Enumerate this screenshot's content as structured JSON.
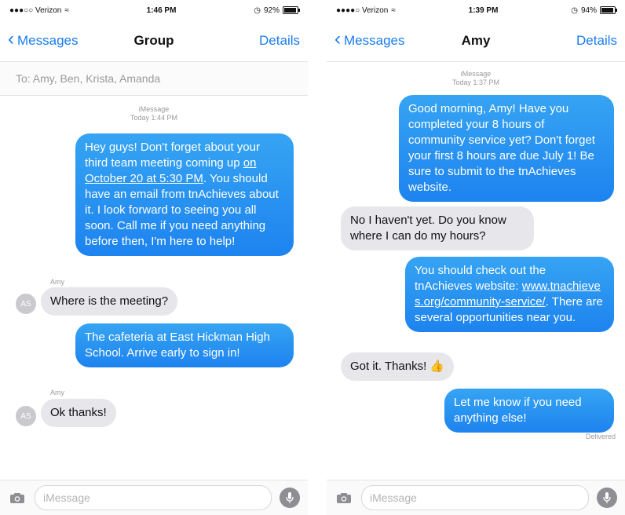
{
  "left": {
    "status": {
      "carrier": "●●●○○ Verizon",
      "time": "1:46 PM",
      "battery": "92%",
      "battery_level": 0.92
    },
    "nav": {
      "back": "Messages",
      "title": "Group",
      "details": "Details"
    },
    "to_field": "To: Amy, Ben, Krista, Amanda",
    "timestamp": {
      "service": "iMessage",
      "time": "Today 1:44 PM"
    },
    "messages": [
      {
        "type": "out",
        "pre": "Hey guys! Don't forget about your third team meeting coming up ",
        "link": "on October 20 at 5:30 PM",
        "post": ". You should have an email from tnAchieves about it. I look forward to seeing you all soon. Call me if you need anything before then, I'm here to help!"
      },
      {
        "type": "in",
        "sender": "Amy",
        "avatar": "AS",
        "text": "Where is the meeting?"
      },
      {
        "type": "out",
        "text": "The cafeteria at East Hickman High School. Arrive early to sign in!"
      },
      {
        "type": "in",
        "sender": "Amy",
        "avatar": "AS",
        "text": "Ok thanks!"
      }
    ],
    "input": {
      "placeholder": "iMessage"
    }
  },
  "right": {
    "status": {
      "carrier": "●●●●○ Verizon",
      "time": "1:39 PM",
      "battery": "94%",
      "battery_level": 0.94
    },
    "nav": {
      "back": "Messages",
      "title": "Amy",
      "details": "Details"
    },
    "timestamp": {
      "service": "iMessage",
      "time": "Today 1:37 PM"
    },
    "messages": [
      {
        "type": "out",
        "text": "Good morning, Amy! Have you completed your 8 hours of community service yet? Don't forget your first 8 hours are due July 1! Be sure to submit to the tnAchieves website."
      },
      {
        "type": "in",
        "text": "No I haven't yet. Do you know where I can do my hours?"
      },
      {
        "type": "out",
        "pre": "You should check out the tnAchieves website: ",
        "link": "www.tnachieves.org/community-service/",
        "post": ". There are several opportunities near you."
      },
      {
        "type": "in",
        "text": "Got it. Thanks! 👍"
      },
      {
        "type": "out",
        "text": "Let me know if you need anything else!"
      }
    ],
    "delivered": "Delivered",
    "input": {
      "placeholder": "iMessage"
    }
  },
  "colors": {
    "accent": "#1a7cf0",
    "bubble_out": "#1d83ef",
    "bubble_in": "#e6e6eb"
  }
}
